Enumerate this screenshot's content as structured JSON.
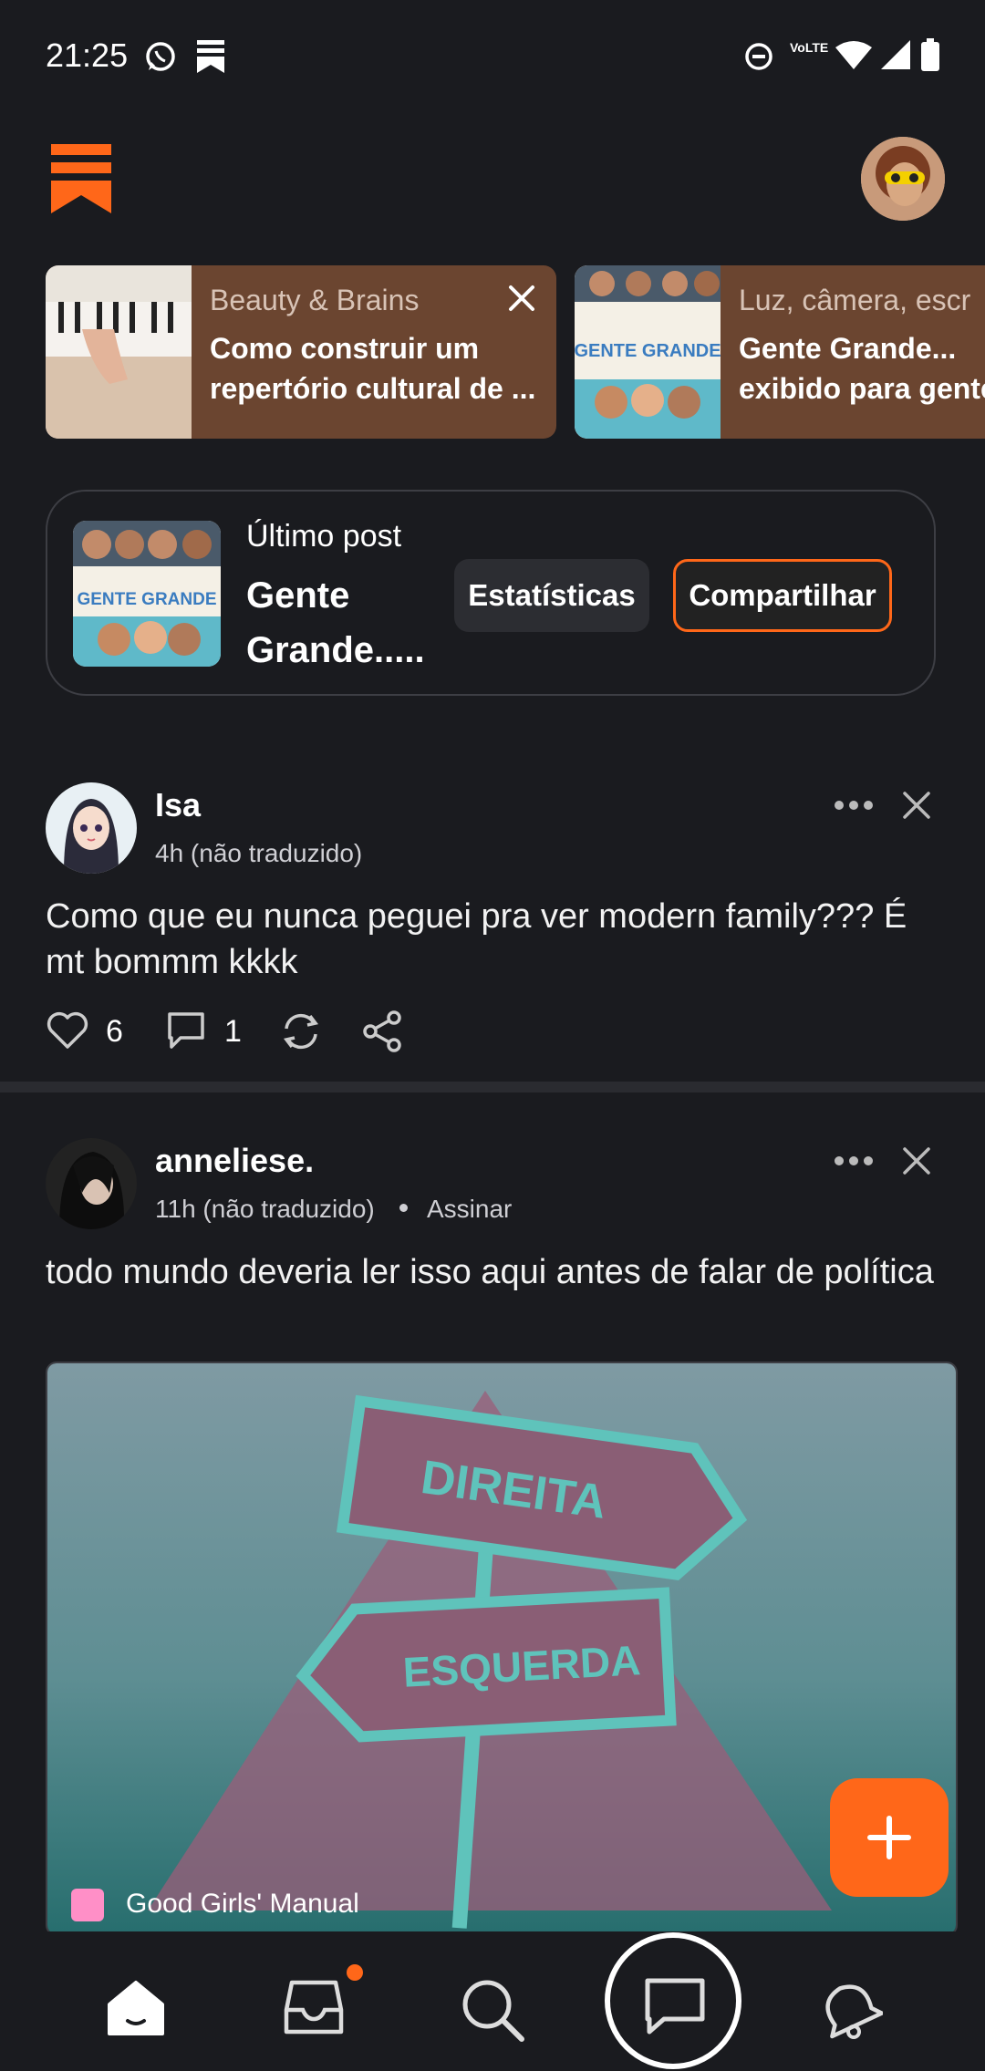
{
  "status_bar": {
    "time": "21:25",
    "network": "VoLTE"
  },
  "recommendations": [
    {
      "publication": "Beauty & Brains",
      "title_line1": "Como construir um",
      "title_line2": "repertório cultural de ..."
    },
    {
      "publication": "Luz, câmera, escr",
      "title_line1": "Gente Grande...",
      "title_line2": "exibido para gente"
    }
  ],
  "last_post": {
    "label": "Último post",
    "title": "Gente Grande.....",
    "stats_label": "Estatísticas",
    "share_label": "Compartilhar",
    "thumb_text": "GENTE GRANDE"
  },
  "posts": [
    {
      "author": "Isa",
      "meta": "4h (não traduzido)",
      "body": "Como que eu nunca peguei pra ver modern family??? É mt bommm kkkk",
      "likes": "6",
      "comments": "1"
    },
    {
      "author": "anneliese.",
      "meta": "11h (não traduzido)",
      "subscribe": "Assinar",
      "body": "todo mundo deveria ler isso aqui antes de falar de política",
      "image_sign_top": "DIREITA",
      "image_sign_bottom": "ESQUERDA",
      "publication": "Good Girls' Manual"
    }
  ],
  "colors": {
    "accent": "#ff6719",
    "background": "#1a1b1f",
    "card": "#6b4530"
  },
  "nav": [
    "home-icon",
    "inbox-icon",
    "search-icon",
    "chat-icon",
    "activity-icon"
  ]
}
